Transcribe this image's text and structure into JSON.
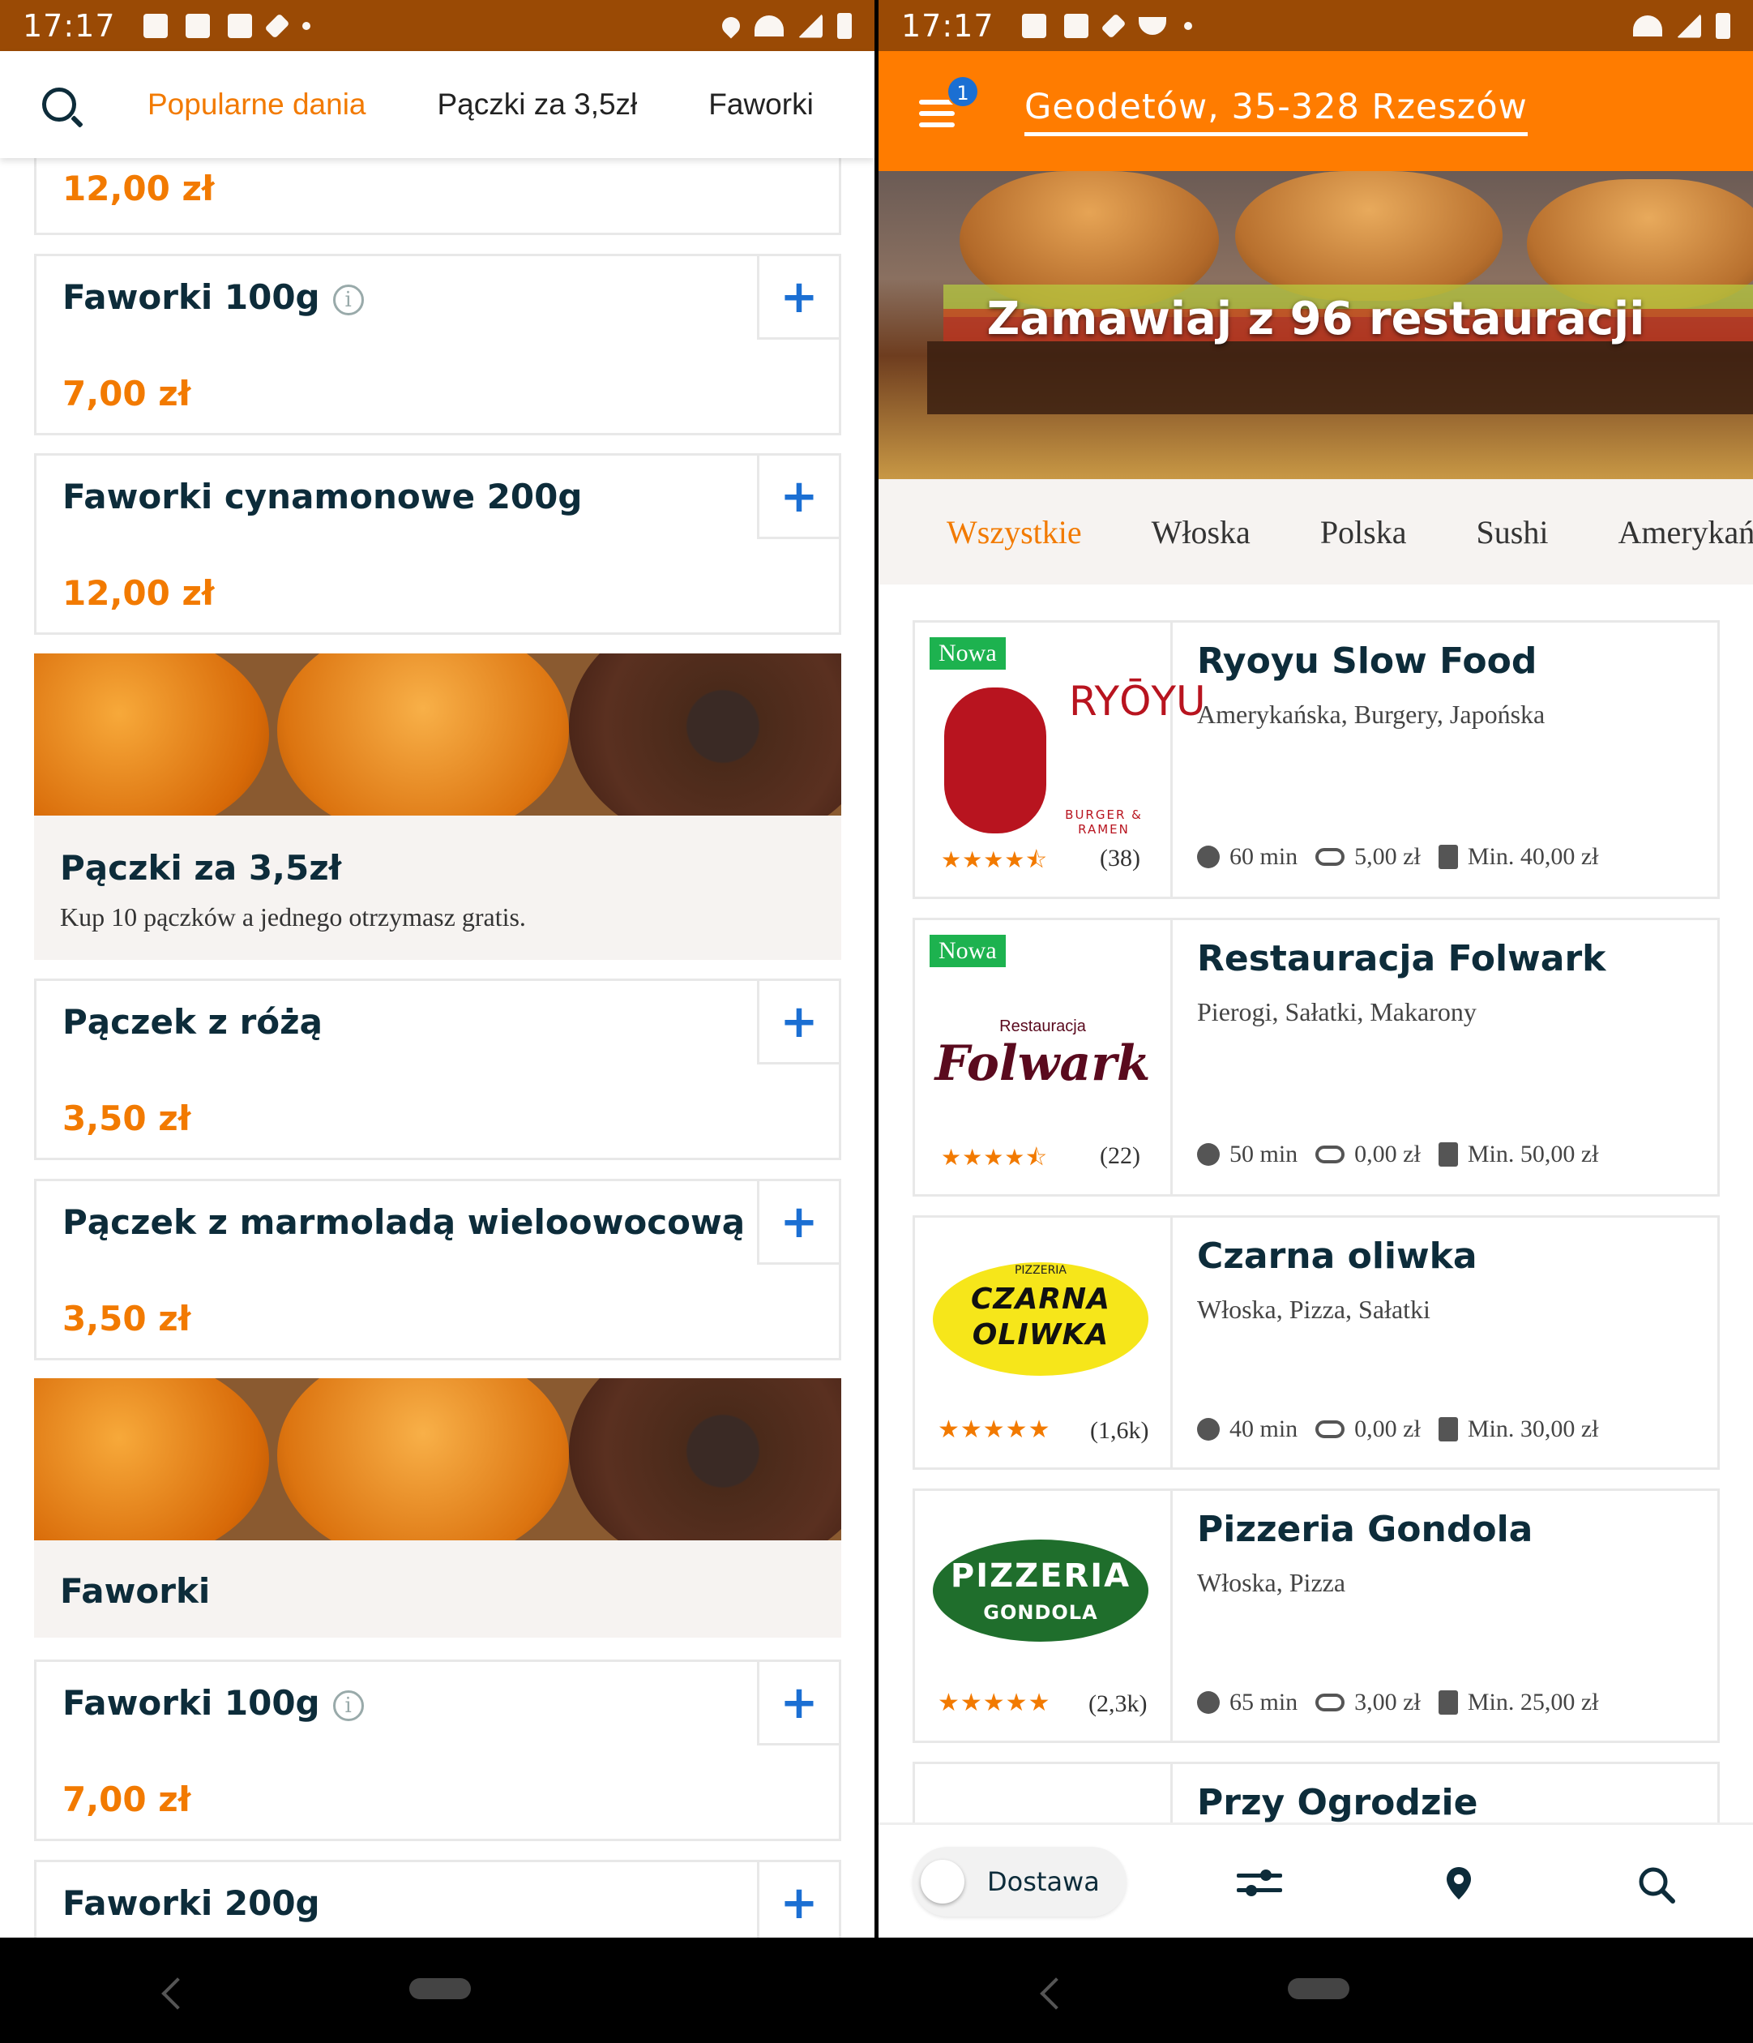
{
  "status_left": {
    "time": "17:17"
  },
  "status_right": {
    "time": "17:17"
  },
  "left": {
    "tabs": [
      "Popularne dania",
      "Pączki za 3,5zł",
      "Faworki"
    ],
    "top_price": "12,00 zł",
    "items": [
      {
        "name": "Faworki 100g",
        "price": "7,00 zł",
        "info": true
      },
      {
        "name": "Faworki cynamonowe 200g",
        "price": "12,00 zł",
        "info": false
      }
    ],
    "promo1": {
      "title": "Pączki za 3,5zł",
      "desc": "Kup 10 pączków a jednego otrzymasz gratis."
    },
    "items2": [
      {
        "name": "Pączek z różą",
        "price": "3,50 zł"
      },
      {
        "name": "Pączek z marmoladą wieloowocową",
        "price": "3,50 zł"
      }
    ],
    "promo2": {
      "title": "Faworki"
    },
    "items3": [
      {
        "name": "Faworki 100g",
        "price": "7,00 zł",
        "info": true
      },
      {
        "name": "Faworki 200g"
      }
    ],
    "plus": "+",
    "info_symbol": "i"
  },
  "right": {
    "badge": "1",
    "address": "Geodetów, 35-328 Rzeszów",
    "hero_title": "Zamawiaj z 96 restauracji",
    "categories": [
      "Wszystkie",
      "Włoska",
      "Polska",
      "Sushi",
      "Amerykańska"
    ],
    "new_label": "Nowa",
    "restaurants": [
      {
        "name": "Ryoyu Slow Food",
        "cuisine": "Amerykańska, Burgery, Japońska",
        "rating": 4.5,
        "count": "(38)",
        "time": "60 min",
        "delivery": "5,00 zł",
        "min": "Min. 40,00 zł",
        "new": true,
        "logo_text": "RYŌYU",
        "logo_sub": "BURGER & RAMEN"
      },
      {
        "name": "Restauracja Folwark",
        "cuisine": "Pierogi, Sałatki, Makarony",
        "rating": 4.5,
        "count": "(22)",
        "time": "50 min",
        "delivery": "0,00 zł",
        "min": "Min. 50,00 zł",
        "new": true,
        "logo_text": "Folwark",
        "logo_sub": "Restauracja"
      },
      {
        "name": "Czarna oliwka",
        "cuisine": "Włoska, Pizza, Sałatki",
        "rating": 5,
        "count": "(1,6k)",
        "time": "40 min",
        "delivery": "0,00 zł",
        "min": "Min. 30,00 zł",
        "new": false,
        "logo_text": "CZARNA OLIWKA",
        "logo_sub": "PIZZERIA"
      },
      {
        "name": "Pizzeria Gondola",
        "cuisine": "Włoska, Pizza",
        "rating": 5,
        "count": "(2,3k)",
        "time": "65 min",
        "delivery": "3,00 zł",
        "min": "Min. 25,00 zł",
        "new": false,
        "logo_text": "PIZZERIA",
        "logo_sub": "GONDOLA"
      },
      {
        "name": "Przy Ogrodzie"
      }
    ],
    "stars": {
      "full": "★★★★★",
      "half": "★★★★⯪"
    },
    "delivery_toggle": "Dostawa",
    "colors": {
      "accent": "#ff7c00",
      "price": "#f27a00",
      "new_badge": "#1db24f",
      "link": "#1b6fd3",
      "text_dark": "#0d2c3a"
    }
  }
}
